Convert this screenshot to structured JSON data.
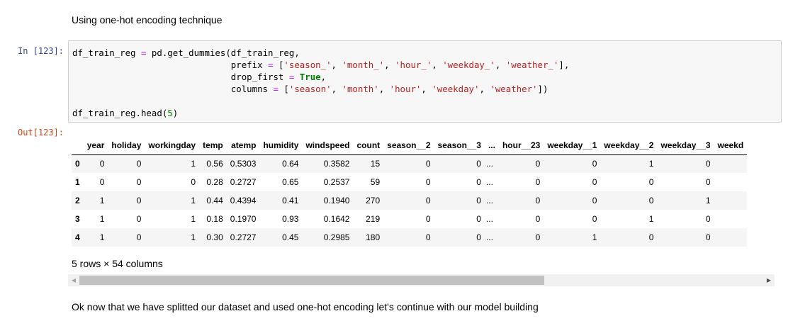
{
  "markdown_top": "Using one-hot encoding technique",
  "in_prompt": "In [123]:",
  "out_prompt": "Out[123]:",
  "code_lines": [
    "df_train_reg = pd.get_dummies(df_train_reg,",
    "                              prefix = ['season_', 'month_', 'hour_', 'weekday_', 'weather_'],",
    "                              drop_first = True,",
    "                              columns = ['season', 'month', 'hour', 'weekday', 'weather'])",
    "",
    "df_train_reg.head(5)"
  ],
  "table": {
    "columns": [
      "",
      "year",
      "holiday",
      "workingday",
      "temp",
      "atemp",
      "humidity",
      "windspeed",
      "count",
      "season__2",
      "season__3",
      "...",
      "hour__23",
      "weekday__1",
      "weekday__2",
      "weekday__3",
      "weekd"
    ],
    "rows": [
      [
        "0",
        "0",
        "0",
        "1",
        "0.56",
        "0.5303",
        "0.64",
        "0.3582",
        "15",
        "0",
        "0",
        "...",
        "0",
        "0",
        "1",
        "0",
        ""
      ],
      [
        "1",
        "0",
        "0",
        "0",
        "0.28",
        "0.2727",
        "0.65",
        "0.2537",
        "59",
        "0",
        "0",
        "...",
        "0",
        "0",
        "0",
        "0",
        ""
      ],
      [
        "2",
        "1",
        "0",
        "1",
        "0.44",
        "0.4394",
        "0.41",
        "0.1940",
        "270",
        "0",
        "0",
        "...",
        "0",
        "0",
        "0",
        "1",
        ""
      ],
      [
        "3",
        "1",
        "0",
        "1",
        "0.18",
        "0.1970",
        "0.93",
        "0.1642",
        "219",
        "0",
        "0",
        "...",
        "0",
        "0",
        "1",
        "0",
        ""
      ],
      [
        "4",
        "1",
        "0",
        "1",
        "0.30",
        "0.2727",
        "0.45",
        "0.2985",
        "180",
        "0",
        "0",
        "...",
        "0",
        "1",
        "0",
        "0",
        ""
      ]
    ]
  },
  "shape_text": "5 rows × 54 columns",
  "scrollbar": {
    "left_arrow": "◀",
    "right_arrow": "▶",
    "thumb_fraction": 0.68
  },
  "markdown_bottom": "Ok now that we have splitted our dataset and used one-hot encoding let's continue with our model building"
}
